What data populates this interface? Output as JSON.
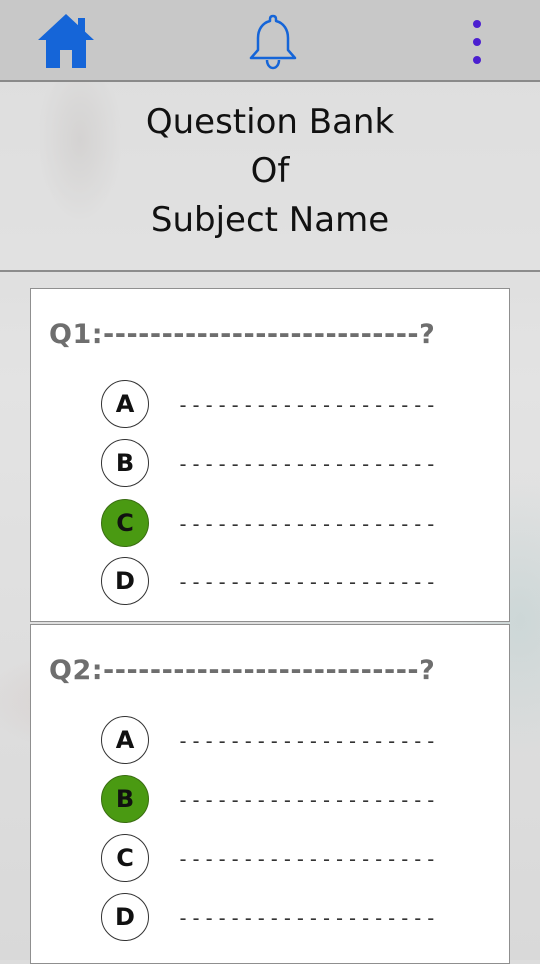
{
  "colors": {
    "accent_blue": "#1565d8",
    "menu_purple": "#4b1fd0",
    "selected_green": "#4a9a12"
  },
  "topbar": {
    "home_icon": "home-icon",
    "bell_icon": "bell-icon",
    "menu_icon": "more-vertical-icon"
  },
  "header": {
    "line1": "Question Bank",
    "line2": "Of",
    "line3": "Subject Name"
  },
  "questions": [
    {
      "title": "Q1:---------------------------?",
      "options": [
        {
          "letter": "A",
          "text": "--------------------",
          "selected": false
        },
        {
          "letter": "B",
          "text": "--------------------",
          "selected": false
        },
        {
          "letter": "C",
          "text": "--------------------",
          "selected": true
        },
        {
          "letter": "D",
          "text": "--------------------",
          "selected": false
        }
      ]
    },
    {
      "title": "Q2:---------------------------?",
      "options": [
        {
          "letter": "A",
          "text": "--------------------",
          "selected": false
        },
        {
          "letter": "B",
          "text": "--------------------",
          "selected": true
        },
        {
          "letter": "C",
          "text": "--------------------",
          "selected": false
        },
        {
          "letter": "D",
          "text": "--------------------",
          "selected": false
        }
      ]
    }
  ]
}
